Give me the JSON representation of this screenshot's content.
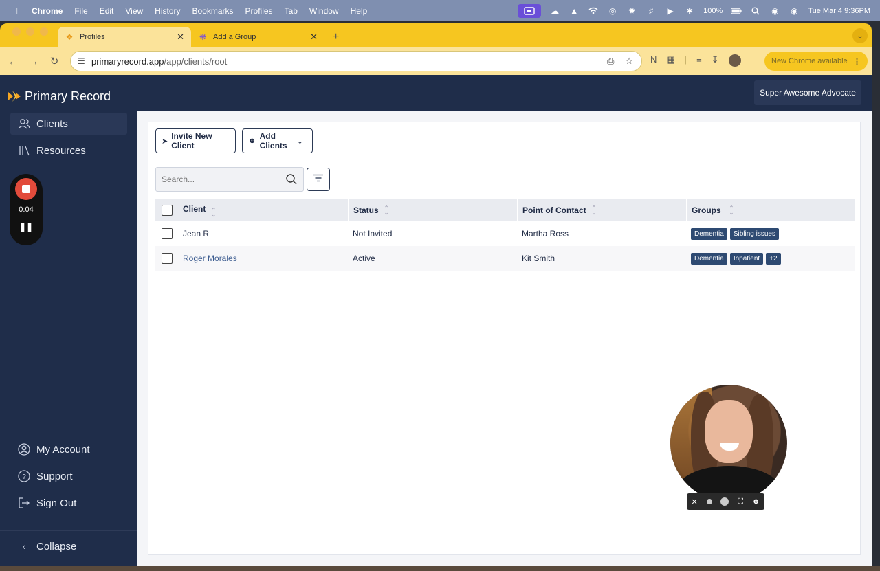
{
  "menubar": {
    "app": "Chrome",
    "items": [
      "File",
      "Edit",
      "View",
      "History",
      "Bookmarks",
      "Profiles",
      "Tab",
      "Window",
      "Help"
    ],
    "battery": "100%",
    "datetime": "Tue Mar 4  9:36PM"
  },
  "tabs": [
    {
      "title": "Profiles",
      "active": true
    },
    {
      "title": "Add a Group",
      "active": false
    }
  ],
  "toolbar": {
    "url_host": "primaryrecord.app",
    "url_path": "/app/clients/root",
    "update_label": "New Chrome available"
  },
  "app": {
    "brand": "Primary Record",
    "user_button": "Super Awesome Advocate",
    "nav": [
      {
        "label": "Clients",
        "icon": "users-icon"
      },
      {
        "label": "Resources",
        "icon": "library-icon"
      }
    ],
    "nav_bottom": [
      {
        "label": "My Account",
        "icon": "user-circle-icon"
      },
      {
        "label": "Support",
        "icon": "help-circle-icon"
      },
      {
        "label": "Sign Out",
        "icon": "sign-out-icon"
      }
    ],
    "collapse_label": "Collapse",
    "recorder_time": "0:04"
  },
  "content": {
    "invite_button": "Invite New Client",
    "add_clients_button": "Add Clients",
    "search_placeholder": "Search...",
    "columns": [
      "Client",
      "Status",
      "Point of Contact",
      "Groups"
    ],
    "rows": [
      {
        "client": "Jean R",
        "status": "Not Invited",
        "contact": "Martha Ross",
        "groups": [
          "Dementia",
          "Sibling issues"
        ],
        "link": false
      },
      {
        "client": "Roger Morales",
        "status": "Active",
        "contact": "Kit Smith",
        "groups": [
          "Dementia",
          "Inpatient",
          "+2"
        ],
        "link": true
      }
    ]
  },
  "colors": {
    "sidebar": "#1f2d4a",
    "tag": "#2e4a72",
    "chrome_accent": "#f6c620",
    "record": "#e24b3b"
  }
}
